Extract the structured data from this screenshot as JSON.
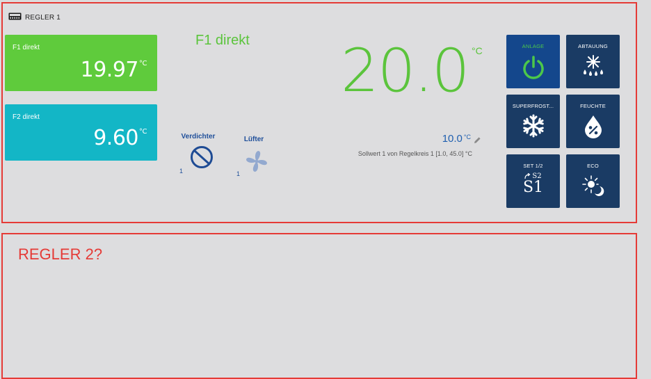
{
  "colors": {
    "border": "#e53a36",
    "green": "#5bc43c",
    "f1_tile": "#5fcb3c",
    "f2_tile": "#13b6c6",
    "button_bg": "#1a3b64",
    "anlage_bg": "#14478c",
    "blue_text": "#1f5fb0"
  },
  "panel1": {
    "header": {
      "icon": "controller-icon",
      "title": "REGLER 1"
    },
    "tiles": [
      {
        "label": "F1 direkt",
        "value": "19.97",
        "unit": "°C"
      },
      {
        "label": "F2 direkt",
        "value": "9.60",
        "unit": "°C"
      }
    ],
    "main_label": "F1 direkt",
    "components": [
      {
        "label": "Verdichter",
        "count": "1",
        "icon": "compressor-icon"
      },
      {
        "label": "Lüfter",
        "count": "1",
        "icon": "fan-icon"
      }
    ],
    "big_temp": {
      "value": "20.0",
      "unit": "°C"
    },
    "setpoint": {
      "value": "10.0",
      "unit": "°C",
      "edit_icon": "pencil-icon"
    },
    "setpoint_description": "Sollwert 1 von Regelkreis 1 [1.0, 45.0] °C",
    "buttons": [
      {
        "label": "ANLAGE",
        "icon": "power-icon"
      },
      {
        "label": "ABTAUUNG",
        "icon": "defrost-icon"
      },
      {
        "label": "SUPERFROST...",
        "icon": "snowflake-icon"
      },
      {
        "label": "FEUCHTE",
        "icon": "humidity-icon"
      },
      {
        "label": "SET 1/2",
        "icon": "setpoint-switch-icon",
        "icon_text_small": "S2",
        "icon_text_big": "S1"
      },
      {
        "label": "ECO",
        "icon": "eco-day-night-icon"
      }
    ]
  },
  "panel2": {
    "title": "REGLER 2?"
  }
}
